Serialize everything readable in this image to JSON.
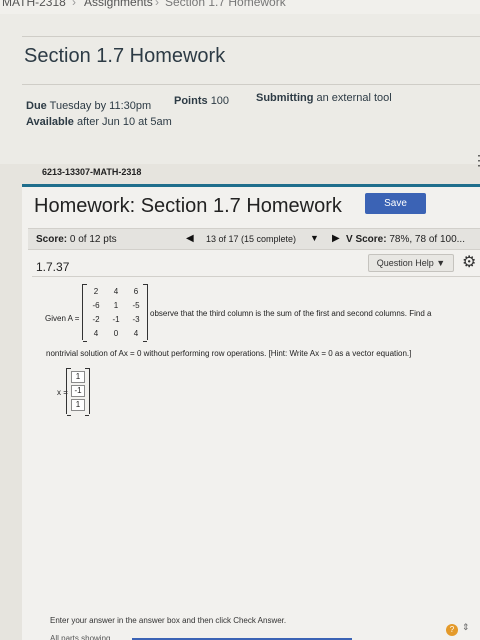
{
  "breadcrumb": {
    "course": "MATH-2318",
    "sep": "›",
    "assignments": "Assignments",
    "current": "Section 1.7 Homework"
  },
  "assignment": {
    "title": "Section 1.7 Homework",
    "due_label": "Due",
    "due_value": "Tuesday by 11:30pm",
    "points_label": "Points",
    "points_value": "100",
    "submitting_label": "Submitting",
    "submitting_value": "an external tool",
    "available_label": "Available",
    "available_value": "after Jun 10 at 5am",
    "course_id": "6213-13307-MATH-2318",
    "kebab": "⋮"
  },
  "homework": {
    "title": "Homework: Section 1.7 Homework",
    "save_label": "Save",
    "score_label": "Score:",
    "score_value": "0 of 12 pts",
    "prev_icon": "◀",
    "nav_status": "13 of 17 (15 complete)",
    "nav_caret": "▼",
    "next_icon": "▶",
    "vscore_label": "V Score:",
    "vscore_value": "78%, 78 of 100...",
    "question_number": "1.7.37",
    "help_label": "Question Help ▼",
    "gear_icon": "⚙"
  },
  "question": {
    "given_label": "Given A =",
    "matrix": [
      [
        "2",
        "4",
        "6"
      ],
      [
        "-6",
        "1",
        "-5"
      ],
      [
        "-2",
        "-1",
        "-3"
      ],
      [
        "4",
        "0",
        "4"
      ]
    ],
    "observe_text": "observe that the third column is the sum of the first and second columns. Find a",
    "observe_text2": "nontrivial solution of Ax = 0 without performing row operations. [Hint: Write Ax = 0 as a vector equation.]",
    "x_label": "x =",
    "x_values": [
      "1",
      "-1",
      "1"
    ]
  },
  "footer": {
    "instructions": "Enter your answer in the answer box and then click Check Answer.",
    "all_parts": "All parts showing",
    "help_circle": "?",
    "updown": "⇕"
  }
}
